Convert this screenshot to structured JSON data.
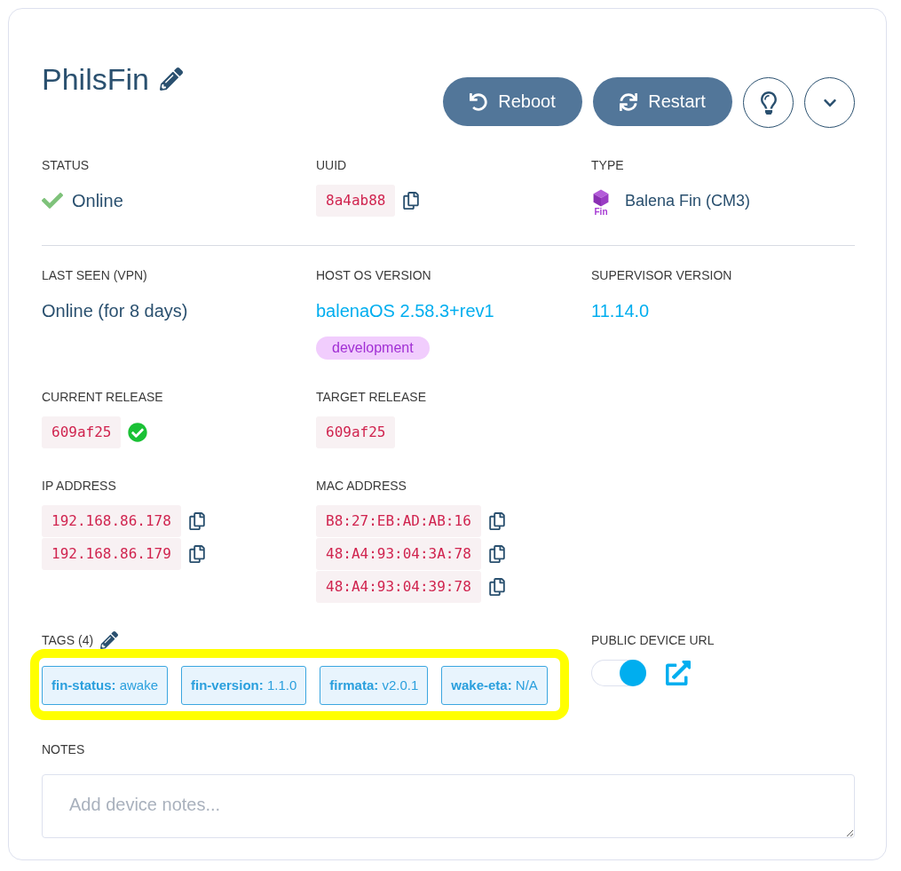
{
  "device": {
    "name": "PhilsFin"
  },
  "actions": [
    {
      "kind": "reboot",
      "label": "Reboot"
    },
    {
      "kind": "restart",
      "label": "Restart"
    },
    {
      "kind": "identify"
    },
    {
      "kind": "more"
    }
  ],
  "summary": [
    {
      "kind": "status",
      "label": "STATUS",
      "value": "Online",
      "online": true
    },
    {
      "kind": "code",
      "label": "UUID",
      "values": [
        "8a4ab88"
      ],
      "copyable": true
    },
    {
      "kind": "device_type",
      "label": "TYPE",
      "icon_caption": "Fin",
      "value": "Balena Fin (CM3)"
    }
  ],
  "details": [
    [
      {
        "kind": "text",
        "label": "LAST SEEN (VPN)",
        "value": "Online (for 8 days)"
      },
      {
        "kind": "link",
        "label": "HOST OS VERSION",
        "value": "balenaOS 2.58.3+rev1",
        "badge": "development"
      },
      {
        "kind": "link",
        "label": "SUPERVISOR VERSION",
        "value": "11.14.0"
      }
    ],
    [
      {
        "kind": "code",
        "label": "CURRENT RELEASE",
        "values": [
          "609af25"
        ],
        "verified": true
      },
      {
        "kind": "code",
        "label": "TARGET RELEASE",
        "values": [
          "609af25"
        ]
      }
    ],
    [
      {
        "kind": "code",
        "label": "IP ADDRESS",
        "values": [
          "192.168.86.178",
          "192.168.86.179"
        ],
        "copyable": true
      },
      {
        "kind": "code",
        "label": "MAC ADDRESS",
        "values": [
          "B8:27:EB:AD:AB:16",
          "48:A4:93:04:3A:78",
          "48:A4:93:04:39:78"
        ],
        "copyable": true
      }
    ]
  ],
  "tags": {
    "label": "TAGS (4)",
    "highlighted": true,
    "items": [
      {
        "text": "**fin-status:** awake"
      },
      {
        "text": "**fin-version:** 1.1.0"
      },
      {
        "text": "**firmata:** v2.0.1"
      },
      {
        "text": "**wake-eta:** N/A"
      }
    ]
  },
  "public_url": {
    "label": "PUBLIC DEVICE URL",
    "on": true
  },
  "notes": {
    "label": "NOTES",
    "placeholder": "Add device notes..."
  }
}
